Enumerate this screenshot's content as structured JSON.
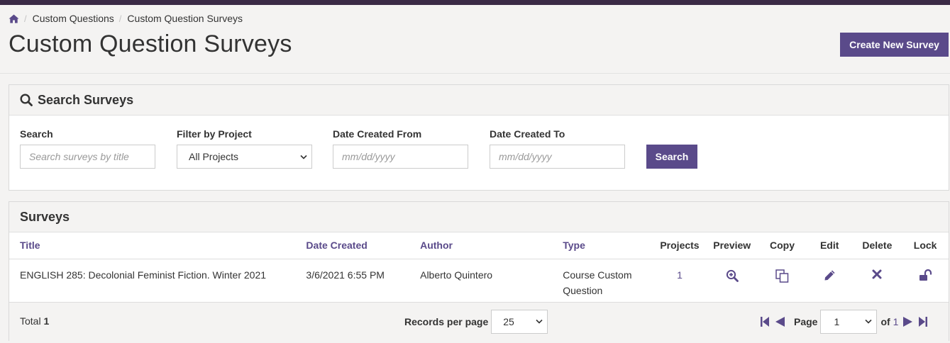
{
  "breadcrumb": {
    "home_icon": "home-icon",
    "items": [
      "Custom Questions",
      "Custom Question Surveys"
    ]
  },
  "page": {
    "title": "Custom Question Surveys",
    "create_button": "Create New Survey"
  },
  "search_panel": {
    "title": "Search Surveys",
    "search_label": "Search",
    "search_placeholder": "Search surveys by title",
    "project_label": "Filter by Project",
    "project_value": "All Projects",
    "from_label": "Date Created From",
    "from_placeholder": "mm/dd/yyyy",
    "to_label": "Date Created To",
    "to_placeholder": "mm/dd/yyyy",
    "search_button": "Search"
  },
  "surveys": {
    "title": "Surveys",
    "columns": [
      "Title",
      "Date Created",
      "Author",
      "Type",
      "Projects",
      "Preview",
      "Copy",
      "Edit",
      "Delete",
      "Lock"
    ],
    "rows": [
      {
        "title": "ENGLISH 285: Decolonial Feminist Fiction. Winter 2021",
        "date_created": "3/6/2021 6:55 PM",
        "author": "Alberto Quintero",
        "type": "Course Custom Question",
        "projects": "1"
      }
    ],
    "footer": {
      "total_label": "Total",
      "total_value": "1",
      "records_label": "Records per page",
      "records_value": "25",
      "page_label": "Page",
      "page_value": "1",
      "of_label": "of",
      "of_value": "1"
    }
  },
  "colors": {
    "accent": "#5a4a8a",
    "topbar": "#3b2a46",
    "background": "#f4f3f2"
  }
}
